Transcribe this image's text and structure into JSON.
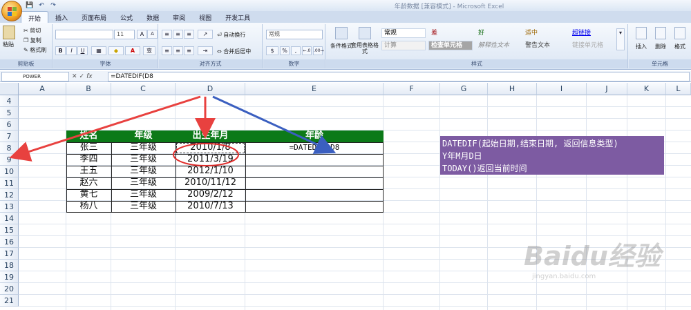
{
  "window": {
    "title": "年龄数据  [兼容模式] - Microsoft Excel"
  },
  "qat": {
    "save": "💾",
    "undo": "↶",
    "redo": "↷"
  },
  "tabs": [
    "开始",
    "插入",
    "页面布局",
    "公式",
    "数据",
    "审阅",
    "视图",
    "开发工具"
  ],
  "ribbon": {
    "clipboard": {
      "paste": "粘贴",
      "cut": "剪切",
      "copy": "复制",
      "format_painter": "格式刷",
      "label": "剪贴板"
    },
    "font": {
      "size": "11",
      "label": "字体",
      "grow": "A",
      "shrink": "A",
      "bold": "B",
      "italic": "I",
      "underline": "U",
      "font_color": "A",
      "fill": "▼",
      "phonetic": "变"
    },
    "alignment": {
      "wrap": "自动换行",
      "merge": "合并后居中",
      "label": "对齐方式"
    },
    "number": {
      "format": "常规",
      "label": "数字",
      "currency": "$",
      "percent": "%",
      "comma": ",",
      "inc_decimal": "←.0",
      "dec_decimal": ".00→"
    },
    "styles": {
      "cond_format": "条件格式",
      "table_format": "套用表格格式",
      "cells": [
        "常规",
        "差",
        "好",
        "适中",
        "超链接",
        "计算",
        "检查单元格",
        "解释性文本",
        "警告文本",
        "链接单元格"
      ],
      "label": "样式"
    },
    "cells": {
      "insert": "插入",
      "delete": "删除",
      "format": "格式",
      "label": "单元格"
    }
  },
  "formula_bar": {
    "name_box": "POWER",
    "cancel": "✕",
    "enter": "✓",
    "fx": "fx",
    "formula": "=DATEDIF(D8"
  },
  "columns": [
    "A",
    "B",
    "C",
    "D",
    "E",
    "F",
    "G",
    "H",
    "I",
    "J",
    "K",
    "L"
  ],
  "rows": [
    "4",
    "5",
    "6",
    "7",
    "8",
    "9",
    "10",
    "11",
    "12",
    "13",
    "14",
    "15",
    "16",
    "17",
    "18",
    "19",
    "20",
    "21"
  ],
  "table": {
    "headers": [
      "姓名",
      "年级",
      "出生年月",
      "年龄"
    ],
    "rows": [
      [
        "张三",
        "三年级",
        "2010/1/8",
        "=DATEDIF(D8"
      ],
      [
        "李四",
        "三年级",
        "2011/3/19",
        ""
      ],
      [
        "王五",
        "三年级",
        "2012/1/10",
        ""
      ],
      [
        "赵六",
        "三年级",
        "2010/11/12",
        ""
      ],
      [
        "黄七",
        "三年级",
        "2009/2/12",
        ""
      ],
      [
        "杨八",
        "三年级",
        "2010/7/13",
        ""
      ]
    ]
  },
  "note": {
    "line1": "DATEDIF(起始日期,结束日期, 返回信息类型)",
    "line2": "Y年M月D日",
    "line3": "TODAY()返回当前时间"
  },
  "watermark": {
    "main": "Baidu经验",
    "sub": "jingyan.baidu.com"
  },
  "colors": {
    "header_green": "#0c7a18",
    "note_purple": "#7d5ba2",
    "arrow_red": "#e8413f",
    "arrow_blue": "#3b5fc0"
  }
}
